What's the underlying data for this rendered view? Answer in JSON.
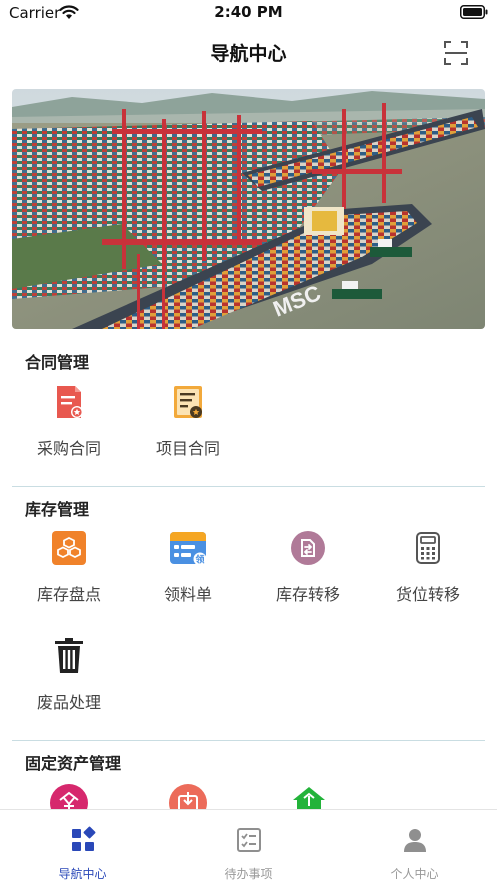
{
  "status_bar": {
    "carrier": "Carrier",
    "time": "2:40 PM"
  },
  "header": {
    "title": "导航中心",
    "scan_icon": "scan-icon"
  },
  "sections": [
    {
      "title": "合同管理",
      "items": [
        {
          "label": "采购合同",
          "icon": "purchase-contract-icon"
        },
        {
          "label": "项目合同",
          "icon": "project-contract-icon"
        }
      ]
    },
    {
      "title": "库存管理",
      "items": [
        {
          "label": "库存盘点",
          "icon": "inventory-check-icon"
        },
        {
          "label": "领料单",
          "icon": "requisition-icon"
        },
        {
          "label": "库存转移",
          "icon": "inventory-transfer-icon"
        },
        {
          "label": "货位转移",
          "icon": "location-transfer-icon"
        },
        {
          "label": "废品处理",
          "icon": "trash-icon"
        }
      ]
    },
    {
      "title": "固定资产管理",
      "items": [
        {
          "icon": "asset-yen-icon"
        },
        {
          "icon": "asset-inbox-icon"
        },
        {
          "icon": "asset-home-icon"
        }
      ]
    }
  ],
  "tabs": [
    {
      "label": "导航中心",
      "icon": "grid-icon",
      "active": true
    },
    {
      "label": "待办事项",
      "icon": "checklist-icon",
      "active": false
    },
    {
      "label": "个人中心",
      "icon": "person-icon",
      "active": false
    }
  ],
  "colors": {
    "accent": "#2a48b8",
    "tab_inactive": "#999999",
    "divider": "#c9dde2"
  }
}
